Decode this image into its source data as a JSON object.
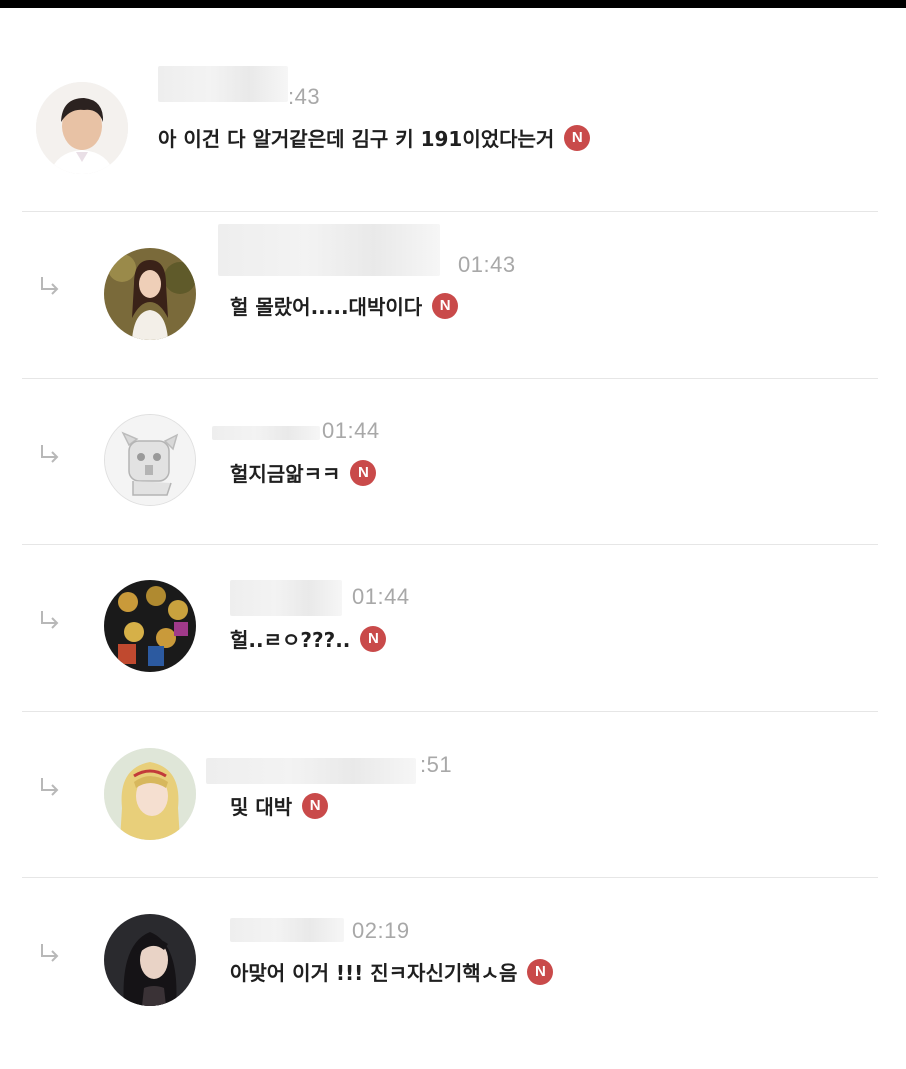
{
  "comments": [
    {
      "time": ":43",
      "text": "아 이건 다 알거같은데 김구 키 191이었다는거",
      "badge": "N",
      "avatar": "man-portrait-avatar",
      "is_reply": false
    },
    {
      "time": "01:43",
      "text": "헐 몰랐어.....대박이다",
      "badge": "N",
      "avatar": "woman-long-hair-avatar",
      "is_reply": true
    },
    {
      "time": "01:44",
      "text": "헐지금앎ㅋㅋ",
      "badge": "N",
      "avatar": "cartoon-dog-avatar",
      "is_reply": true
    },
    {
      "time": "01:44",
      "text": "헐..ㄹㅇ???..",
      "badge": "N",
      "avatar": "group-photo-avatar",
      "is_reply": true
    },
    {
      "time": ":51",
      "text": "및 대박",
      "badge": "N",
      "avatar": "blonde-woman-avatar",
      "is_reply": true
    },
    {
      "time": "02:19",
      "text": "아맞어 이거 !!! 진ㅋ자신기핵ㅅ음",
      "badge": "N",
      "avatar": "dark-hair-woman-avatar",
      "is_reply": true
    }
  ],
  "colors": {
    "badge": "#c94a4a",
    "timestamp": "#a8a8a8",
    "divider": "#e6e6e6"
  }
}
